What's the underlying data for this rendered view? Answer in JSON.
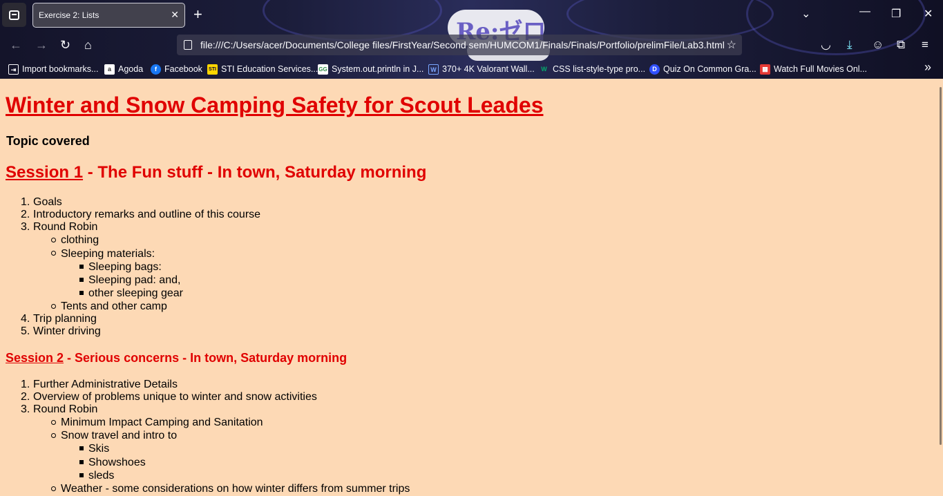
{
  "browser": {
    "tab_title": "Exercise 2: Lists",
    "url": "file:///C:/Users/acer/Documents/College files/FirstYear/Second sem/HUMCOM1/Finals/Finals/Portfolio/prelimFile/Lab3.html",
    "logo_text": "Re:ゼロ",
    "bookmarks": [
      {
        "label": "Import bookmarks...",
        "icon": "import-icon",
        "color": "#fbfbfe"
      },
      {
        "label": "Agoda",
        "icon": "agoda-icon",
        "color": "#ffffff"
      },
      {
        "label": "Facebook",
        "icon": "facebook-icon",
        "color": "#1877f2"
      },
      {
        "label": "STI Education Services...",
        "icon": "sti-icon",
        "color": "#ffd600"
      },
      {
        "label": "System.out.println in J...",
        "icon": "gfg-icon",
        "color": "#ffffff"
      },
      {
        "label": "370+ 4K Valorant Wall...",
        "icon": "wallpaper-icon",
        "color": "#7aa6ff"
      },
      {
        "label": "CSS list-style-type pro...",
        "icon": "w3schools-icon",
        "color": "#04aa6d"
      },
      {
        "label": "Quiz On Common Gra...",
        "icon": "quiz-icon",
        "color": "#3050ff"
      },
      {
        "label": "Watch Full Movies Onl...",
        "icon": "movie-icon",
        "color": "#e53935"
      }
    ]
  },
  "page": {
    "title": "Winter and Snow Camping Safety for Scout Leades",
    "topic_heading": "Topic covered",
    "session1": {
      "num": "Session 1",
      "rest": " - The Fun stuff - In town, Saturday morning",
      "items": [
        "Goals",
        "Introductory remarks and outline of this course",
        "Round Robin",
        "Trip planning",
        "Winter driving"
      ],
      "round_robin": [
        "clothing",
        "Sleeping materials:",
        "Tents and other camp"
      ],
      "sleeping": [
        "Sleeping bags:",
        "Sleeping pad: and,",
        "other sleeping gear"
      ]
    },
    "session2": {
      "num": "Session 2",
      "rest": " - Serious concerns - In town, Saturday morning",
      "items": [
        "Further Administrative Details",
        "Overview of problems unique to winter and snow activities",
        "Round Robin"
      ],
      "round_robin": [
        "Minimum Impact Camping and Sanitation",
        "Snow travel and intro to",
        "Weather - some considerations on how winter differs from summer trips"
      ],
      "snow_travel": [
        "Skis",
        "Showshoes",
        "sleds"
      ]
    }
  }
}
